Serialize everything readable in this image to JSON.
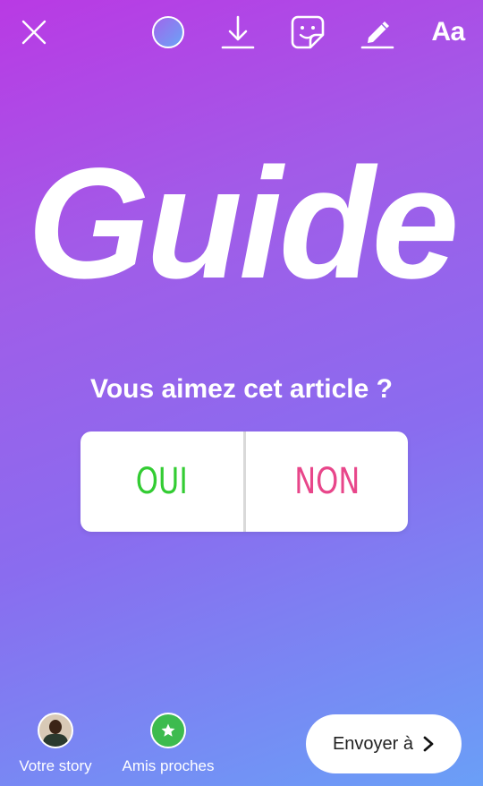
{
  "toolbar": {
    "close_icon": "close-icon",
    "color_icon": "color-palette-icon",
    "download_icon": "download-icon",
    "sticker_icon": "sticker-icon",
    "draw_icon": "draw-icon",
    "text_tool_label": "Aa"
  },
  "headline": "Guide",
  "poll": {
    "question": "Vous aimez cet article ?",
    "options": [
      "OUI",
      "NON"
    ],
    "option_colors": [
      "#33cc33",
      "#e8468a"
    ]
  },
  "bottom_bar": {
    "your_story_label": "Votre story",
    "close_friends_label": "Amis proches",
    "send_label": "Envoyer à",
    "send_icon": "chevron-right-icon",
    "close_friends_icon": "star-icon"
  },
  "colors": {
    "gradient_start": "#b93ae4",
    "gradient_end": "#6a9ff7",
    "close_friends_green": "#3dbb4f"
  }
}
